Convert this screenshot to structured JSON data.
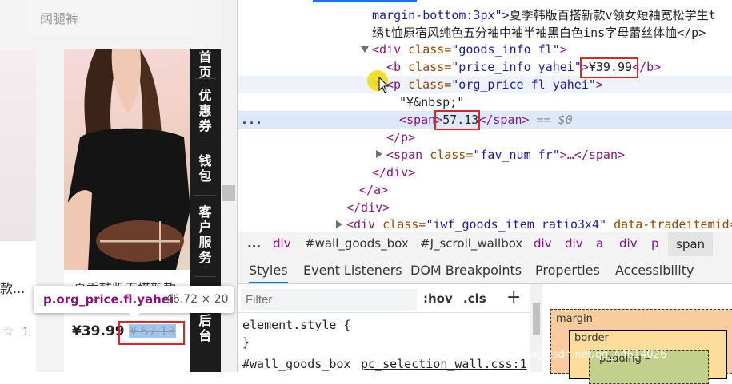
{
  "page": {
    "search_placeholder": "阔腿裤",
    "left_card_title": "款...",
    "product_title": "夏季韩版百搭新款",
    "price": "¥39.99",
    "original_price": "¥ 57.13",
    "favorites": "1",
    "sidebar": [
      "首页",
      "优惠券",
      "钱包",
      "客户服务",
      "后台"
    ]
  },
  "tooltip": {
    "selector": "p.org_price.fl.yahei",
    "size": "46.72 × 20"
  },
  "devtools": {
    "lines": {
      "l1_attr": "margin-bottom:3px\">",
      "l1_text": "夏季韩版百搭新款v领女短袖宽松学生t",
      "l2_text": "绣t恤原宿风纯色五分袖中袖半袖黑白色ins字母蕾丝体恤</p>",
      "goods_info_open": "<div",
      "goods_info_class_attr": "class=",
      "goods_info_class_val": "\"goods_info fl\"",
      "b_tag": "<b",
      "b_class_attr": "class=",
      "b_class_val": "\"price_info yahei\"",
      "b_text": "¥39.99",
      "b_close": "</b>",
      "p_tag": "p",
      "p_class_attr": "class=",
      "p_class_val": "\"org_price fl yahei\"",
      "p_gt": ">",
      "nbsp_line": "\"¥&nbsp;\"",
      "span_open": "<span",
      "span_text": "57.13",
      "span_close": "</span>",
      "dollar0": "== $0",
      "dots": "...",
      "p_close": "</p>",
      "fav_span": "<span",
      "fav_class_attr": "class=",
      "fav_class_val": "\"fav_num fr\"",
      "fav_rest": ">…</span>",
      "div_close1": "</div>",
      "a_close": "</a>",
      "div_close2": "</div>",
      "next_div_open": "<div",
      "next_div_class_attr": "class=",
      "next_div_class_val": "\"iwf_goods_item ratio3x4\"",
      "next_div_attr2": "data-tradeitemid="
    },
    "breadcrumbs": [
      "...",
      "div",
      "#wall_goods_box",
      "#J_scroll_wallbox",
      "div",
      "div",
      "a",
      "div",
      "p",
      "span"
    ],
    "tabs": [
      "Styles",
      "Event Listeners",
      "DOM Breakpoints",
      "Properties",
      "Accessibility"
    ],
    "filter_placeholder": "Filter",
    "hov": ":hov",
    "cls": ".cls",
    "plus": "+",
    "styles": {
      "element_style": "element.style {",
      "close_brace": "}",
      "rule_selector": "#wall_goods_box",
      "rule_source": "pc_selection_wall.css:1"
    },
    "box_model": {
      "margin": "margin",
      "margin_val": "–",
      "border": "border",
      "border_val": "–",
      "padding": "padding –"
    }
  },
  "watermark": "https://blog.csdn.net/qq_44614026"
}
